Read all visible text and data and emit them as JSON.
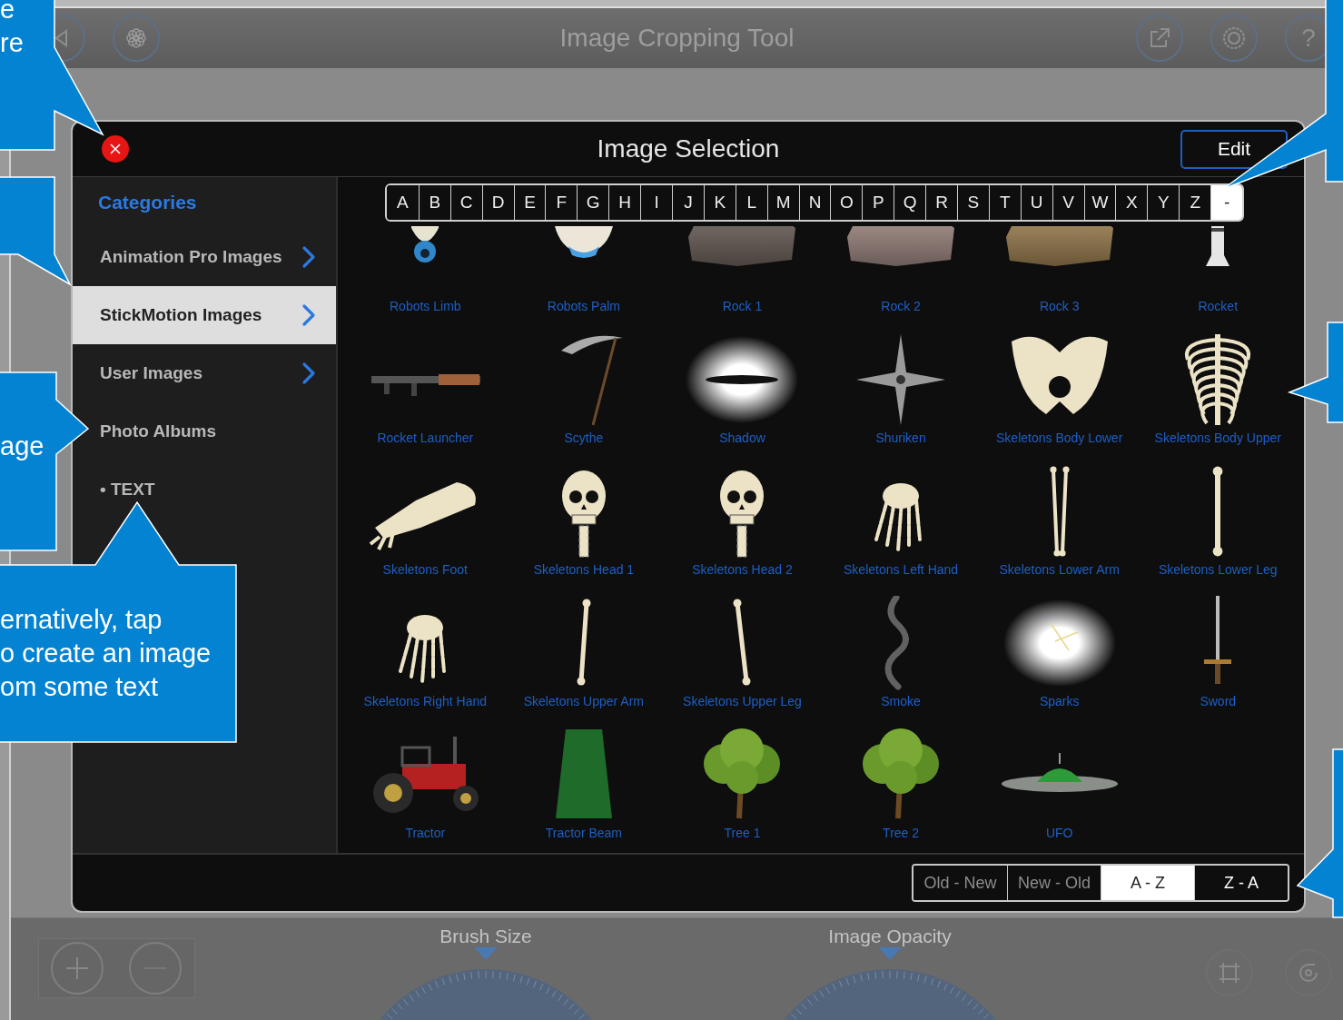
{
  "top_bar": {
    "title": "Image Cropping Tool",
    "help_glyph": "?"
  },
  "dialog": {
    "title": "Image Selection",
    "edit_button": "Edit",
    "sidebar": {
      "heading": "Categories",
      "items": [
        {
          "label": "Animation Pro Images",
          "kind": "folder",
          "selected": false
        },
        {
          "label": "StickMotion Images",
          "kind": "folder",
          "selected": true
        },
        {
          "label": "User Images",
          "kind": "folder",
          "selected": false
        },
        {
          "label": "Photo Albums",
          "kind": "plain",
          "selected": false
        },
        {
          "label": "• TEXT",
          "kind": "plain",
          "selected": false
        }
      ]
    },
    "letters": [
      {
        "label": "A",
        "selected": false
      },
      {
        "label": "B",
        "selected": false
      },
      {
        "label": "C",
        "selected": false
      },
      {
        "label": "D",
        "selected": false
      },
      {
        "label": "E",
        "selected": false
      },
      {
        "label": "F",
        "selected": false
      },
      {
        "label": "G",
        "selected": false
      },
      {
        "label": "H",
        "selected": false
      },
      {
        "label": "I",
        "selected": false
      },
      {
        "label": "J",
        "selected": false
      },
      {
        "label": "K",
        "selected": false
      },
      {
        "label": "L",
        "selected": false
      },
      {
        "label": "M",
        "selected": false
      },
      {
        "label": "N",
        "selected": false
      },
      {
        "label": "O",
        "selected": false
      },
      {
        "label": "P",
        "selected": false
      },
      {
        "label": "Q",
        "selected": false
      },
      {
        "label": "R",
        "selected": false
      },
      {
        "label": "S",
        "selected": false
      },
      {
        "label": "T",
        "selected": false
      },
      {
        "label": "U",
        "selected": false
      },
      {
        "label": "V",
        "selected": false
      },
      {
        "label": "W",
        "selected": false
      },
      {
        "label": "X",
        "selected": false
      },
      {
        "label": "Y",
        "selected": false
      },
      {
        "label": "Z",
        "selected": false
      },
      {
        "label": "-",
        "selected": true
      }
    ],
    "images": [
      {
        "label": "Robots Limb"
      },
      {
        "label": "Robots Palm"
      },
      {
        "label": "Rock 1"
      },
      {
        "label": "Rock 2"
      },
      {
        "label": "Rock 3"
      },
      {
        "label": "Rocket"
      },
      {
        "label": "Rocket Launcher"
      },
      {
        "label": "Scythe"
      },
      {
        "label": "Shadow"
      },
      {
        "label": "Shuriken"
      },
      {
        "label": "Skeletons Body Lower"
      },
      {
        "label": "Skeletons Body Upper"
      },
      {
        "label": "Skeletons Foot"
      },
      {
        "label": "Skeletons Head 1"
      },
      {
        "label": "Skeletons Head 2"
      },
      {
        "label": "Skeletons Left Hand"
      },
      {
        "label": "Skeletons Lower Arm"
      },
      {
        "label": "Skeletons Lower Leg"
      },
      {
        "label": "Skeletons Right Hand"
      },
      {
        "label": "Skeletons Upper Arm"
      },
      {
        "label": "Skeletons Upper Leg"
      },
      {
        "label": "Smoke"
      },
      {
        "label": "Sparks"
      },
      {
        "label": "Sword"
      },
      {
        "label": "Tractor"
      },
      {
        "label": "Tractor Beam"
      },
      {
        "label": "Tree 1"
      },
      {
        "label": "Tree 2"
      },
      {
        "label": "UFO"
      }
    ],
    "sort_options": [
      {
        "label": "Old - New",
        "selected": false,
        "disabled": true
      },
      {
        "label": "New - Old",
        "selected": false,
        "disabled": true
      },
      {
        "label": "A - Z",
        "selected": true,
        "disabled": false
      },
      {
        "label": "Z - A",
        "selected": false,
        "disabled": false
      }
    ]
  },
  "bottom_panel": {
    "dials": [
      {
        "label": "Brush Size"
      },
      {
        "label": "Image Opacity"
      }
    ]
  },
  "callouts": [
    {
      "kind": "right",
      "lines": [
        "e",
        "re"
      ]
    },
    {
      "kind": "down"
    },
    {
      "kind": "right",
      "lines": [
        "age"
      ]
    },
    {
      "kind": "up",
      "lines": [
        "ernatively, tap",
        "o create an image",
        "om some text"
      ]
    },
    {
      "kind": "left"
    },
    {
      "kind": "left"
    },
    {
      "kind": "left"
    }
  ]
}
